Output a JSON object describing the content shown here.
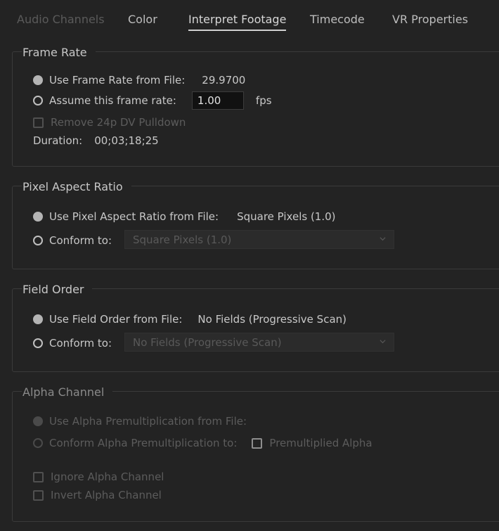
{
  "tabs": [
    {
      "label": "Audio Channels",
      "state": "disabled"
    },
    {
      "label": "Color",
      "state": "normal"
    },
    {
      "label": "Interpret Footage",
      "state": "active"
    },
    {
      "label": "Timecode",
      "state": "normal"
    },
    {
      "label": "VR Properties",
      "state": "normal"
    }
  ],
  "frame_rate": {
    "title": "Frame Rate",
    "use_from_file_label": "Use Frame Rate from File:",
    "file_value": "29.9700",
    "assume_label": "Assume this frame rate:",
    "assume_value": "1.00",
    "fps_unit": "fps",
    "remove_pulldown_label": "Remove 24p DV Pulldown",
    "duration_label": "Duration:",
    "duration_value": "00;03;18;25"
  },
  "pixel_aspect": {
    "title": "Pixel Aspect Ratio",
    "use_from_file_label": "Use Pixel Aspect Ratio from File:",
    "file_value": "Square Pixels (1.0)",
    "conform_label": "Conform to:",
    "conform_selected": "Square Pixels (1.0)"
  },
  "field_order": {
    "title": "Field Order",
    "use_from_file_label": "Use Field Order from File:",
    "file_value": "No Fields (Progressive Scan)",
    "conform_label": "Conform to:",
    "conform_selected": "No Fields (Progressive Scan)"
  },
  "alpha_channel": {
    "title": "Alpha Channel",
    "use_premult_label": "Use Alpha Premultiplication from File:",
    "conform_premult_label": "Conform Alpha Premultiplication to:",
    "premultiplied_label": "Premultiplied Alpha",
    "ignore_label": "Ignore Alpha Channel",
    "invert_label": "Invert Alpha Channel"
  },
  "colors": {
    "background": "#232323",
    "text": "#c8c8c8",
    "disabled_text": "#5c5c5c",
    "input_bg": "#111111"
  },
  "icons": {
    "dropdown": "chevron-down-icon"
  }
}
